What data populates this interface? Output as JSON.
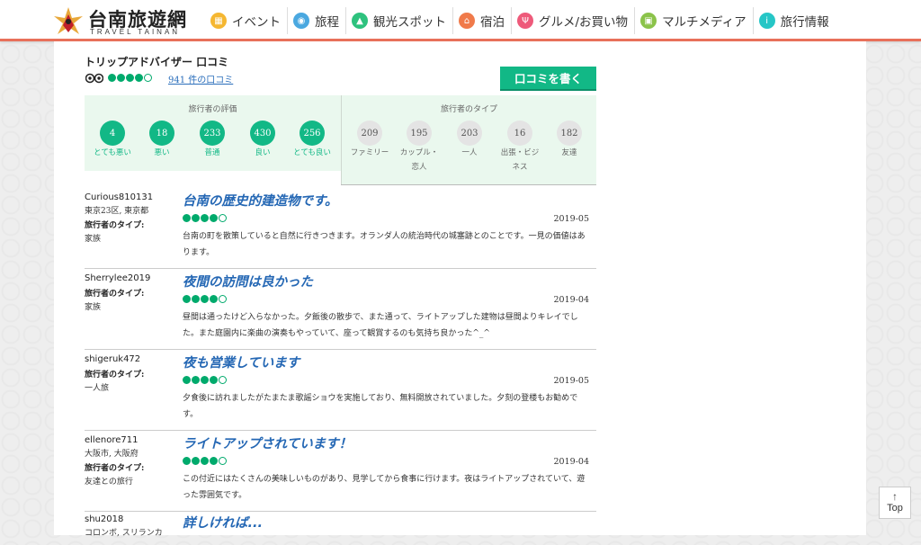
{
  "header": {
    "logo_cn": "台南旅遊網",
    "logo_en": "TRAVEL TAINAN",
    "nav": [
      {
        "label": "イベント",
        "icon": "calendar-icon",
        "color": "#f5b731"
      },
      {
        "label": "旅程",
        "icon": "guide-icon",
        "color": "#4aa8e0"
      },
      {
        "label": "観光スポット",
        "icon": "mountain-icon",
        "color": "#2ec27e"
      },
      {
        "label": "宿泊",
        "icon": "house-icon",
        "color": "#f07a4a"
      },
      {
        "label": "グルメ/お買い物",
        "icon": "fork-knife-icon",
        "color": "#ee5a7a"
      },
      {
        "label": "マルチメディア",
        "icon": "media-icon",
        "color": "#8bc34a"
      },
      {
        "label": "旅行情報",
        "icon": "info-icon",
        "color": "#26c6c6"
      }
    ]
  },
  "tripadvisor": {
    "title": "トリップアドバイザー 口コミ",
    "rating_bubbles": 4,
    "review_count": "941 件の口コミ",
    "write_button": "口コミを書く"
  },
  "ratings": {
    "heading": "旅行者の評価",
    "items": [
      {
        "count": "4",
        "label": "とても悪い"
      },
      {
        "count": "18",
        "label": "悪い"
      },
      {
        "count": "233",
        "label": "普通"
      },
      {
        "count": "430",
        "label": "良い"
      },
      {
        "count": "256",
        "label": "とても良い"
      }
    ]
  },
  "traveler_types": {
    "heading": "旅行者のタイプ",
    "items": [
      {
        "count": "209",
        "label": "ファミリー"
      },
      {
        "count": "195",
        "label": "カップル・",
        "label2": "恋人"
      },
      {
        "count": "203",
        "label": "一人"
      },
      {
        "count": "16",
        "label": "出張・ビジ",
        "label2": "ネス"
      },
      {
        "count": "182",
        "label": "友達"
      }
    ]
  },
  "reviews": [
    {
      "user": "Curious810131",
      "location": "東京23区, 東京都",
      "type_label": "旅行者のタイプ:",
      "type_value": "家族",
      "title": "台南の歴史的建造物です。",
      "bubbles": 4,
      "date": "2019-05",
      "text": "台南の町を散策していると自然に行きつきます。オランダ人の統治時代の城塞跡とのことです。一見の価値はあります。"
    },
    {
      "user": "Sherrylee2019",
      "location": "",
      "type_label": "旅行者のタイプ:",
      "type_value": "家族",
      "title": "夜間の訪問は良かった",
      "bubbles": 4,
      "date": "2019-04",
      "text": "昼間は通ったけど入らなかった。夕飯後の散歩で、また通って、ライトアップした建物は昼間よりキレイでした。また庭園内に楽曲の演奏もやっていて、座って観賞するのも気持ち良かった^_^"
    },
    {
      "user": "shigeruk472",
      "location": "",
      "type_label": "旅行者のタイプ:",
      "type_value": "一人旅",
      "title": "夜も営業しています",
      "bubbles": 4,
      "date": "2019-05",
      "text": "夕食後に訪れましたがたまたま歌謡ショウを実施しており、無料開放されていました。夕刻の登楼もお勧めです。"
    },
    {
      "user": "ellenore711",
      "location": "大阪市, 大阪府",
      "type_label": "旅行者のタイプ:",
      "type_value": "友達との旅行",
      "title": "ライトアップされています！",
      "bubbles": 4,
      "date": "2019-04",
      "text": "この付近にはたくさんの美味しいものがあり、見学してから食事に行けます。夜はライトアップされていて、遊った雰囲気です。"
    },
    {
      "user": "shu2018",
      "location": "コロンボ, スリランカ",
      "title": "詳しければ..."
    }
  ],
  "top_button": {
    "arrow": "↑",
    "label": "Top"
  }
}
